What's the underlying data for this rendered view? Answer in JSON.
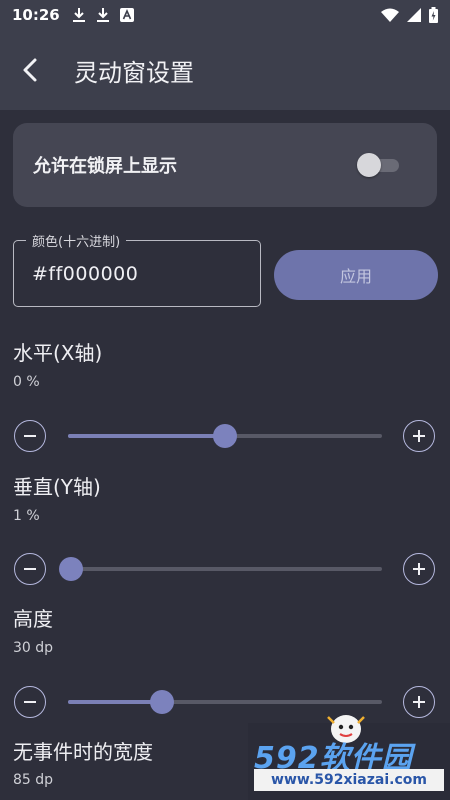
{
  "status_bar": {
    "time": "10:26",
    "left_icons": [
      "download-icon",
      "download-icon",
      "font-a-icon"
    ],
    "right_icons": [
      "wifi-icon",
      "signal-icon",
      "battery-icon"
    ]
  },
  "app_bar": {
    "title": "灵动窗设置",
    "back_icon": "back-arrow-icon"
  },
  "lock_screen": {
    "label": "允许在锁屏上显示",
    "enabled": false
  },
  "color": {
    "legend": "颜色(十六进制)",
    "value": "#ff000000",
    "apply_label": "应用"
  },
  "sliders": [
    {
      "label": "水平(X轴)",
      "value_text": "0 %",
      "fraction": 0.5
    },
    {
      "label": "垂直(Y轴)",
      "value_text": "1 %",
      "fraction": 0.01
    },
    {
      "label": "高度",
      "value_text": "30 dp",
      "fraction": 0.3
    },
    {
      "label": "无事件时的宽度",
      "value_text": "85 dp"
    }
  ],
  "watermark": {
    "brand": "592软件园",
    "url": "www.592xiazai.com"
  },
  "colors": {
    "background": "#2e2f3b",
    "app_bar": "#3d3f4c",
    "card": "#454653",
    "accent": "#7c82bd",
    "apply_button": "#6e74ab"
  }
}
